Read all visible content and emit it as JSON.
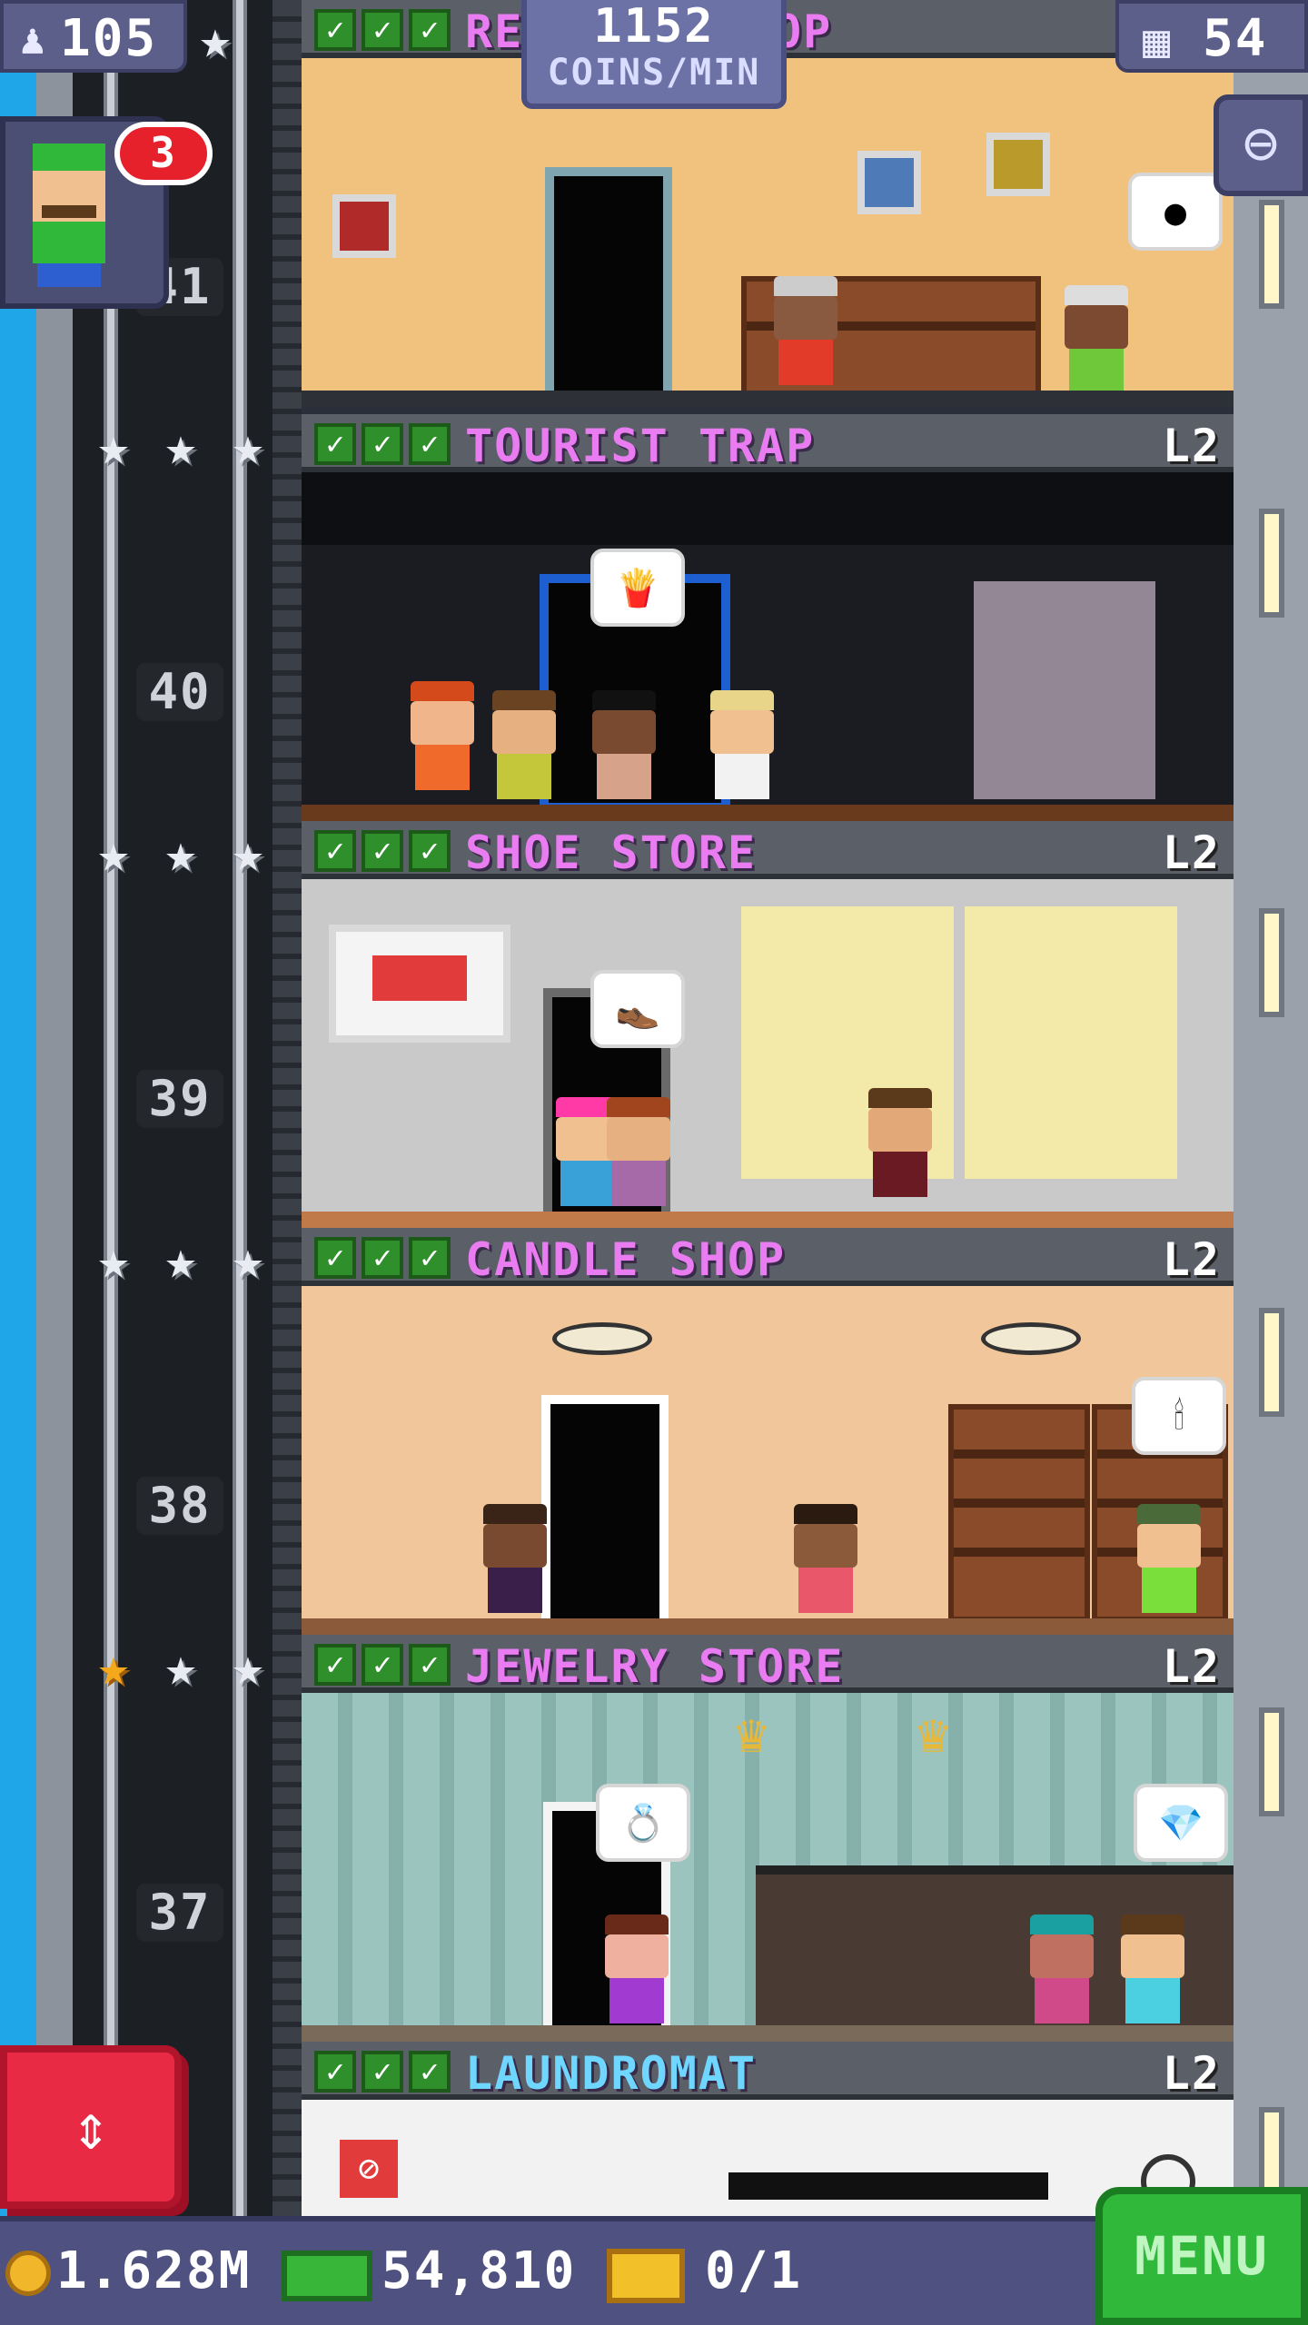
{
  "hud": {
    "population": "105",
    "coins_per_min_value": "1152",
    "coins_per_min_label": "COINS/MIN",
    "floor_count": "54"
  },
  "mission": {
    "badge_count": "3"
  },
  "elevator": {
    "floor_numbers": [
      "41",
      "40",
      "39",
      "38",
      "37"
    ]
  },
  "floors": [
    {
      "name": "RE",
      "name_tail": "OP",
      "level": "",
      "check_count": 3
    },
    {
      "name": "TOURIST TRAP",
      "level": "L2",
      "check_count": 3
    },
    {
      "name": "SHOE STORE",
      "level": "L2",
      "check_count": 3
    },
    {
      "name": "CANDLE SHOP",
      "level": "L2",
      "check_count": 3
    },
    {
      "name": "JEWELRY STORE",
      "level": "L2",
      "check_count": 3
    },
    {
      "name": "LAUNDROMAT",
      "level": "L2",
      "check_count": 3
    }
  ],
  "bottom_bar": {
    "coins": "1.628M",
    "bux": "54,810",
    "tickets": "0/1",
    "menu_label": "MENU"
  },
  "colors": {
    "header_text_pink": "#e87cf0",
    "header_text_blue": "#6fd6ff",
    "elevator_button": "#e82a45",
    "menu_button": "#2fb83a",
    "hud_panel": "#5b5f8a"
  }
}
